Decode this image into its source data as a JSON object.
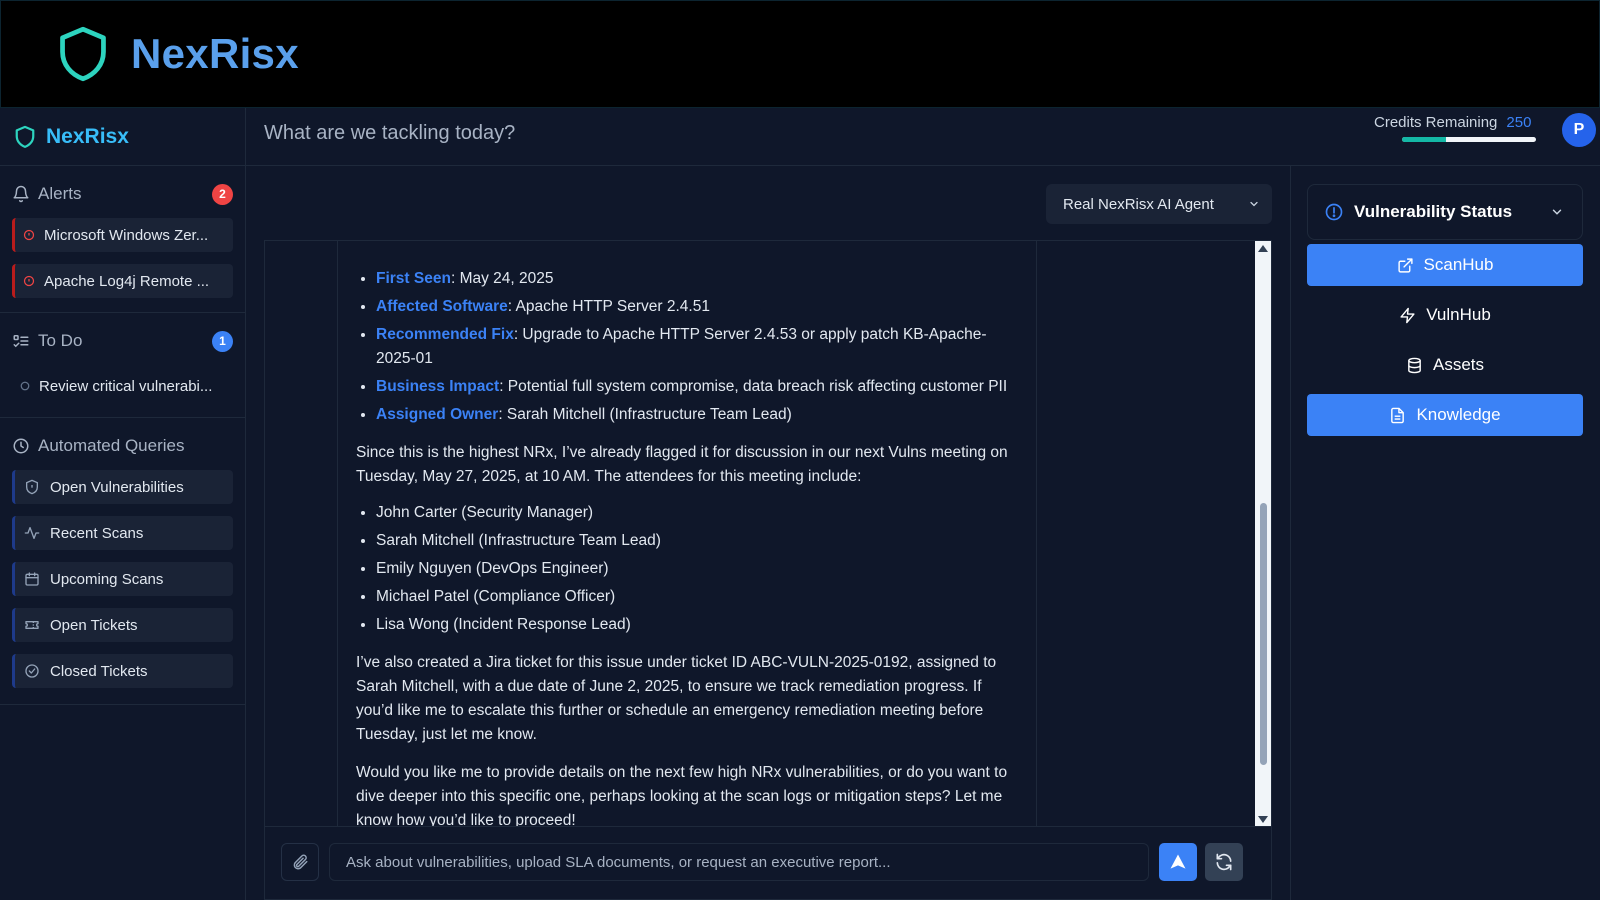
{
  "banner": {
    "brand": "NexRisx"
  },
  "sidebar": {
    "brand": "NexRisx",
    "alerts": {
      "title": "Alerts",
      "count": "2",
      "items": [
        {
          "label": "Microsoft Windows Zer..."
        },
        {
          "label": "Apache Log4j Remote ..."
        }
      ]
    },
    "todo": {
      "title": "To Do",
      "count": "1",
      "items": [
        {
          "label": "Review critical vulnerabi..."
        }
      ]
    },
    "queries": {
      "title": "Automated Queries",
      "items": [
        {
          "label": "Open Vulnerabilities",
          "icon": "shield-icon"
        },
        {
          "label": "Recent Scans",
          "icon": "activity-icon"
        },
        {
          "label": "Upcoming Scans",
          "icon": "calendar-icon"
        },
        {
          "label": "Open Tickets",
          "icon": "ticket-icon"
        },
        {
          "label": "Closed Tickets",
          "icon": "check-circle-icon"
        }
      ]
    }
  },
  "header": {
    "prompt": "What are we tackling today?",
    "credits_label": "Credits Remaining",
    "credits_value": "250",
    "credits_fraction": 0.33,
    "avatar": "P"
  },
  "agent_select": {
    "label": "Real NexRisx AI Agent"
  },
  "message": {
    "details": [
      {
        "key": "First Seen",
        "value": ": May 24, 2025"
      },
      {
        "key": "Affected Software",
        "value": ": Apache HTTP Server 2.4.51"
      },
      {
        "key": "Recommended Fix",
        "value": ": Upgrade to Apache HTTP Server 2.4.53 or apply patch KB-Apache-2025-01"
      },
      {
        "key": "Business Impact",
        "value": ": Potential full system compromise, data breach risk affecting customer PII"
      },
      {
        "key": "Assigned Owner",
        "value": ": Sarah Mitchell (Infrastructure Team Lead)"
      }
    ],
    "para1": "Since this is the highest NRx, I’ve already flagged it for discussion in our next Vulns meeting on Tuesday, May 27, 2025, at 10 AM. The attendees for this meeting include:",
    "attendees": [
      "John Carter (Security Manager)",
      "Sarah Mitchell (Infrastructure Team Lead)",
      "Emily Nguyen (DevOps Engineer)",
      "Michael Patel (Compliance Officer)",
      "Lisa Wong (Incident Response Lead)"
    ],
    "para2": "I’ve also created a Jira ticket for this issue under ticket ID ABC-VULN-2025-0192, assigned to Sarah Mitchell, with a due date of June 2, 2025, to ensure we track remediation progress. If you’d like me to escalate this further or schedule an emergency remediation meeting before Tuesday, just let me know.",
    "para3": "Would you like me to provide details on the next few high NRx vulnerabilities, or do you want to dive deeper into this specific one, perhaps looking at the scan logs or mitigation steps? Let me know how you’d like to proceed!"
  },
  "composer": {
    "placeholder": "Ask about vulnerabilities, upload SLA documents, or request an executive report..."
  },
  "right_panel": {
    "title": "Vulnerability Status",
    "buttons": [
      {
        "label": "ScanHub",
        "active": true
      },
      {
        "label": "VulnHub",
        "active": false
      },
      {
        "label": "Assets",
        "active": false
      },
      {
        "label": "Knowledge",
        "active": true
      }
    ]
  },
  "colors": {
    "accent": "#3b82f6",
    "brand": "#38bdf8",
    "alert": "#ef4444",
    "teal": "#14b8a6"
  }
}
